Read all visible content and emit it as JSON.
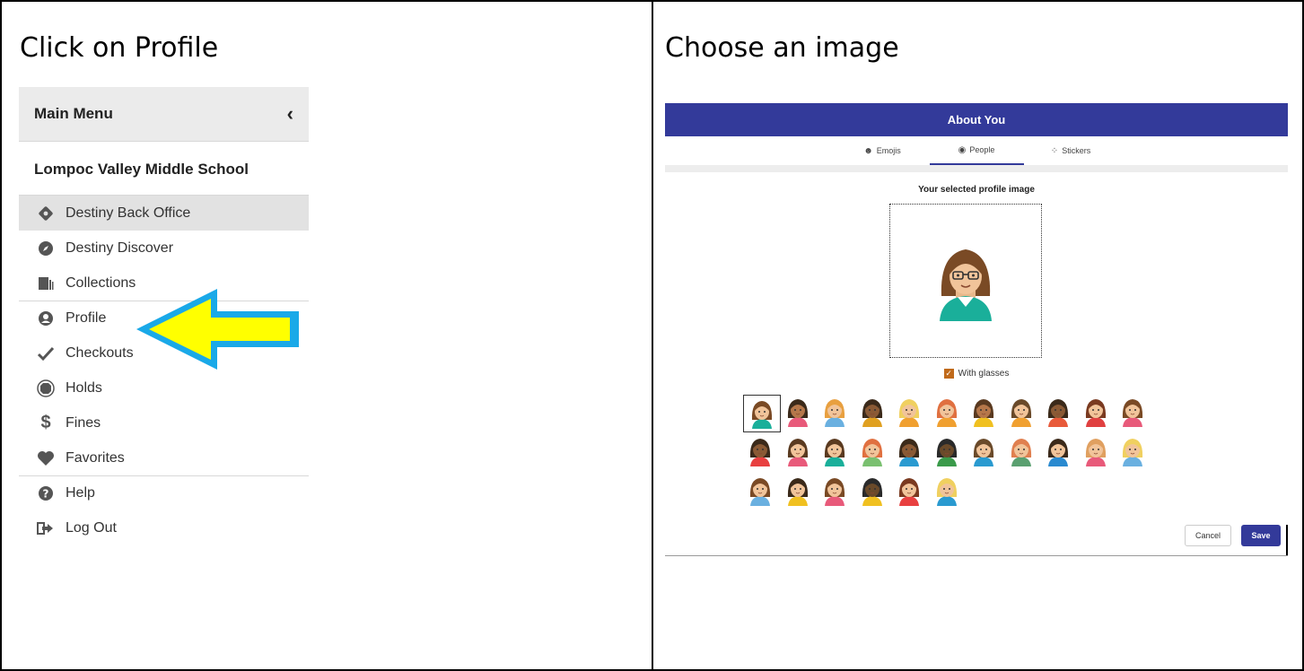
{
  "left_step": {
    "title": "Click on Profile"
  },
  "right_step": {
    "title": "Choose an image"
  },
  "menu": {
    "header": "Main Menu",
    "collapse_icon": "chevron-left-icon",
    "school": "Lompoc Valley Middle School",
    "items": [
      {
        "label": "Destiny Back Office",
        "icon": "diamond-icon",
        "active": true
      },
      {
        "label": "Destiny Discover",
        "icon": "compass-icon"
      },
      {
        "label": "Collections",
        "icon": "collections-icon"
      },
      {
        "label": "Profile",
        "icon": "user-circle-icon"
      },
      {
        "label": "Checkouts",
        "icon": "check-icon"
      },
      {
        "label": "Holds",
        "icon": "octagon-icon"
      },
      {
        "label": "Fines",
        "icon": "dollar-icon"
      },
      {
        "label": "Favorites",
        "icon": "heart-icon"
      },
      {
        "label": "Help",
        "icon": "question-icon"
      },
      {
        "label": "Log Out",
        "icon": "logout-icon"
      }
    ]
  },
  "annotation": {
    "arrow_color": "#ffff00",
    "arrow_border": "#1aa9e8"
  },
  "dialog": {
    "title": "About You",
    "tabs": [
      {
        "label": "Emojis",
        "icon": "smiley-icon"
      },
      {
        "label": "People",
        "icon": "user-circle-icon",
        "active": true
      },
      {
        "label": "Stickers",
        "icon": "paw-icon"
      }
    ],
    "selected_title": "Your selected profile image",
    "with_glasses_label": "With glasses",
    "with_glasses_checked": true,
    "cancel_label": "Cancel",
    "save_label": "Save",
    "accent_color": "#333a9a"
  }
}
